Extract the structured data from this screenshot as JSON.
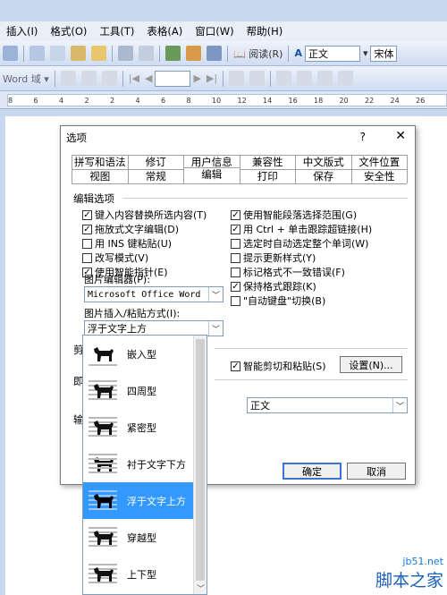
{
  "menubar": [
    "插入(I)",
    "格式(O)",
    "工具(T)",
    "表格(A)",
    "窗口(W)",
    "帮助(H)"
  ],
  "toolbar1": {
    "reading_label": "阅读(R)",
    "style_value": "正文",
    "font_partial": "宋体"
  },
  "toolbar2": {
    "word_field_label": "Word 域"
  },
  "ruler_ticks": [
    "8",
    "6",
    "4",
    "2",
    "2",
    "4",
    "6",
    "8",
    "10",
    "12",
    "14",
    "16",
    "18",
    "20",
    "22",
    "24",
    "26"
  ],
  "dialog": {
    "title": "选项",
    "help": "?",
    "close": "✕",
    "tabs_row1": [
      "拼写和语法",
      "修订",
      "用户信息",
      "兼容性",
      "中文版式",
      "文件位置"
    ],
    "tabs_row2": [
      "视图",
      "常规",
      "编辑",
      "打印",
      "保存",
      "安全性"
    ],
    "active_tab": "编辑",
    "section_title": "编辑选项",
    "left_options": [
      {
        "label": "键入内容替换所选内容(T)",
        "checked": true
      },
      {
        "label": "拖放式文字编辑(D)",
        "checked": true
      },
      {
        "label": "用 INS 键粘贴(U)",
        "checked": false
      },
      {
        "label": "改写模式(V)",
        "checked": false
      },
      {
        "label": "使用智能指针(E)",
        "checked": true
      }
    ],
    "right_options": [
      {
        "label": "使用智能段落选择范围(G)",
        "checked": true
      },
      {
        "label": "用 Ctrl + 单击跟踪超链接(H)",
        "checked": true
      },
      {
        "label": "选定时自动选定整个单词(W)",
        "checked": false
      },
      {
        "label": "提示更新样式(Y)",
        "checked": false
      },
      {
        "label": "标记格式不一致错误(F)",
        "checked": false
      },
      {
        "label": "保持格式跟踪(K)",
        "checked": true
      },
      {
        "label": "\"自动键盘\"切换(B)",
        "checked": false
      }
    ],
    "picture_editor_label": "图片编辑器(P):",
    "picture_editor_value": "Microsoft Office Word",
    "insert_paste_label": "图片插入/粘贴方式(I):",
    "insert_paste_value": "浮于文字上方",
    "cut_paste_section_partial": "剪",
    "click_type_partial": "即",
    "input_partial": "输",
    "smart_cut_label": "智能剪切和粘贴(S)",
    "smart_cut_checked": true,
    "settings_button": "设置(N)...",
    "default_style_value": "正文",
    "ok_button": "确定",
    "cancel_button": "取消"
  },
  "wrap_options": [
    {
      "label": "嵌入型",
      "selected": false
    },
    {
      "label": "四周型",
      "selected": false
    },
    {
      "label": "紧密型",
      "selected": false
    },
    {
      "label": "衬于文字下方",
      "selected": false
    },
    {
      "label": "浮于文字上方",
      "selected": true
    },
    {
      "label": "穿越型",
      "selected": false
    },
    {
      "label": "上下型",
      "selected": false
    }
  ],
  "watermark": {
    "line1": "jb51.net",
    "line2": "脚本之家"
  }
}
